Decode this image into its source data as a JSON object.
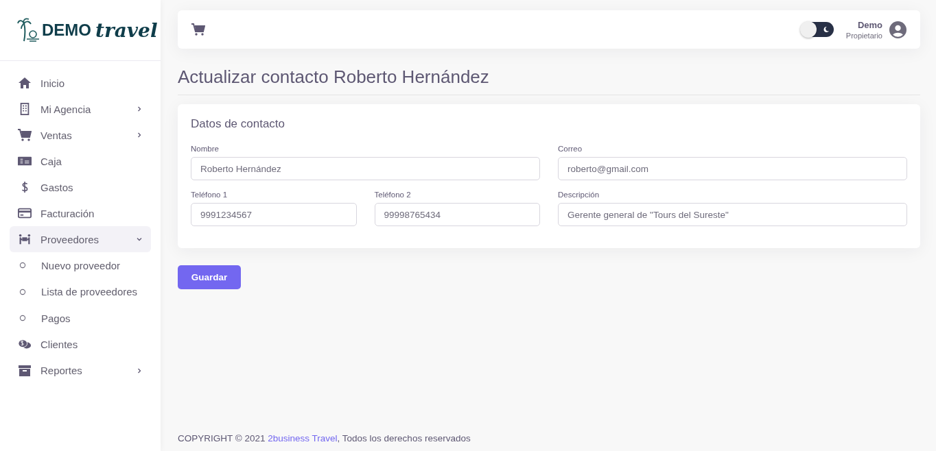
{
  "logo": {
    "text": "DEMO",
    "script": "travel"
  },
  "sidebar": {
    "items": [
      {
        "label": "Inicio",
        "has_submenu": false,
        "expanded": false
      },
      {
        "label": "Mi Agencia",
        "has_submenu": true,
        "expanded": false
      },
      {
        "label": "Ventas",
        "has_submenu": true,
        "expanded": false
      },
      {
        "label": "Caja",
        "has_submenu": false,
        "expanded": false
      },
      {
        "label": "Gastos",
        "has_submenu": false,
        "expanded": false
      },
      {
        "label": "Facturación",
        "has_submenu": false,
        "expanded": false
      },
      {
        "label": "Proveedores",
        "has_submenu": true,
        "expanded": true,
        "children": [
          {
            "label": "Nuevo proveedor"
          },
          {
            "label": "Lista de proveedores"
          },
          {
            "label": "Pagos"
          }
        ]
      },
      {
        "label": "Clientes",
        "has_submenu": false,
        "expanded": false
      },
      {
        "label": "Reportes",
        "has_submenu": true,
        "expanded": false
      }
    ]
  },
  "header": {
    "dark_mode": false,
    "user": {
      "name": "Demo",
      "role": "Propietario"
    }
  },
  "page_title": "Actualizar contacto Roberto Hernández",
  "card": {
    "title": "Datos de contacto",
    "fields": [
      {
        "label": "Nombre",
        "value": "Roberto Hernández"
      },
      {
        "label": "Correo",
        "value": "roberto@gmail.com"
      },
      {
        "label": "Teléfono 1",
        "value": "9991234567"
      },
      {
        "label": "Teléfono 2",
        "value": "99998765434"
      },
      {
        "label": "Descripción",
        "value": "Gerente general de \"Tours del Sureste\""
      }
    ]
  },
  "save_button": "Guardar",
  "footer": {
    "prefix": "COPYRIGHT © 2021 ",
    "link": "2business Travel",
    "suffix": ", Todos los derechos reservados"
  }
}
